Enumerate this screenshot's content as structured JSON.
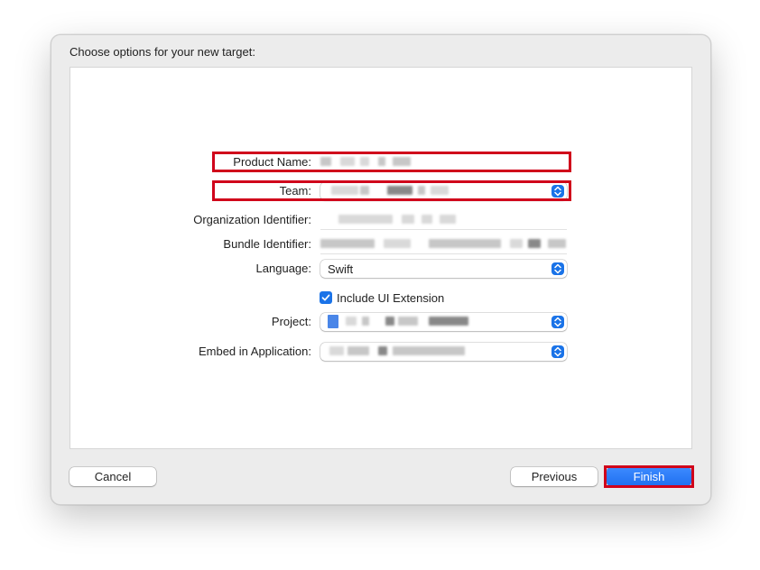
{
  "dialog": {
    "title": "Choose options for your new target:"
  },
  "form": {
    "product_name": {
      "label": "Product Name:",
      "value": ""
    },
    "team": {
      "label": "Team:",
      "value": ""
    },
    "organization_identifier": {
      "label": "Organization Identifier:",
      "value": ""
    },
    "bundle_identifier": {
      "label": "Bundle Identifier:",
      "value": ""
    },
    "language": {
      "label": "Language:",
      "value": "Swift"
    },
    "include_ui_extension": {
      "label": "Include UI Extension",
      "checked": true
    },
    "project": {
      "label": "Project:",
      "value": ""
    },
    "embed_in_application": {
      "label": "Embed in Application:",
      "value": ""
    }
  },
  "buttons": {
    "cancel": "Cancel",
    "previous": "Previous",
    "finish": "Finish"
  },
  "icons": {
    "popup_chevron": "chevron-up-down-icon",
    "checkbox_check": "checkmark-icon",
    "project_icon": "xcode-project-icon"
  },
  "colors": {
    "accent": "#1a73e8",
    "highlight_annotation": "#d0021b",
    "primary_button": "#2a7bf6"
  }
}
